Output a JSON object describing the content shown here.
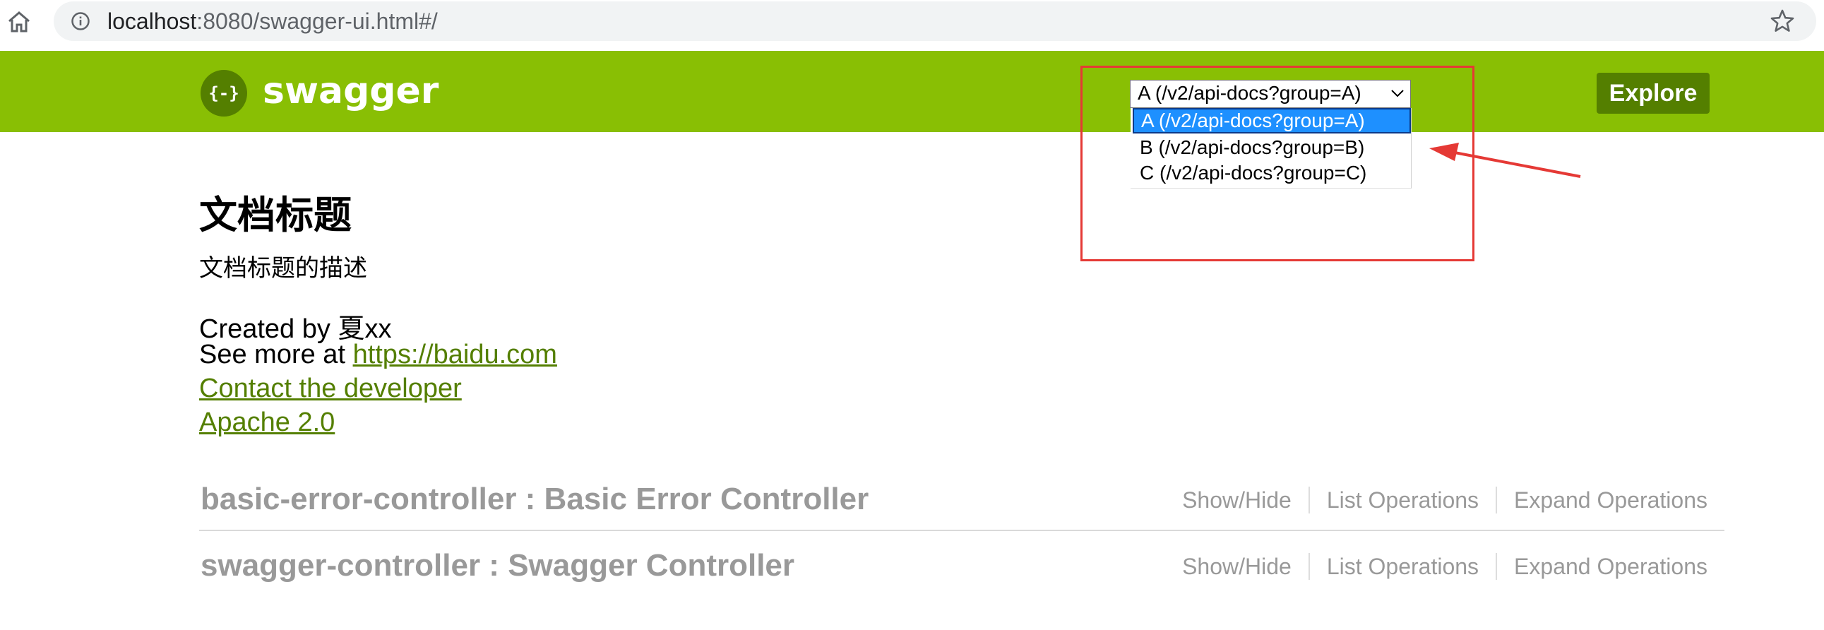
{
  "browser": {
    "url_host": "localhost",
    "url_rest": ":8080/swagger-ui.html#/",
    "icons": {
      "home": "home-icon",
      "info": "info-icon",
      "bookmark": "star-icon"
    }
  },
  "header": {
    "logo_glyph": "{-}",
    "logo_text": "swagger",
    "select_value": "A (/v2/api-docs?group=A)",
    "explore_label": "Explore",
    "colors": {
      "header_bg": "#89bf04",
      "button_bg": "#547f00"
    }
  },
  "dropdown": {
    "options": [
      "A (/v2/api-docs?group=A)",
      "B (/v2/api-docs?group=B)",
      "C (/v2/api-docs?group=C)"
    ],
    "selected_index": 0
  },
  "info": {
    "title": "文档标题",
    "description": "文档标题的描述",
    "created_by": "Created by 夏xx",
    "see_more_prefix": "See more at ",
    "see_more_link": "https://baidu.com",
    "contact_link": "Contact the developer",
    "license_link": "Apache 2.0"
  },
  "controllers": [
    {
      "name": "basic-error-controller : Basic Error Controller",
      "ops": [
        "Show/Hide",
        "List Operations",
        "Expand Operations"
      ]
    },
    {
      "name": "swagger-controller : Swagger Controller",
      "ops": [
        "Show/Hide",
        "List Operations",
        "Expand Operations"
      ]
    }
  ],
  "annotation": {
    "box_color": "#e53935"
  }
}
